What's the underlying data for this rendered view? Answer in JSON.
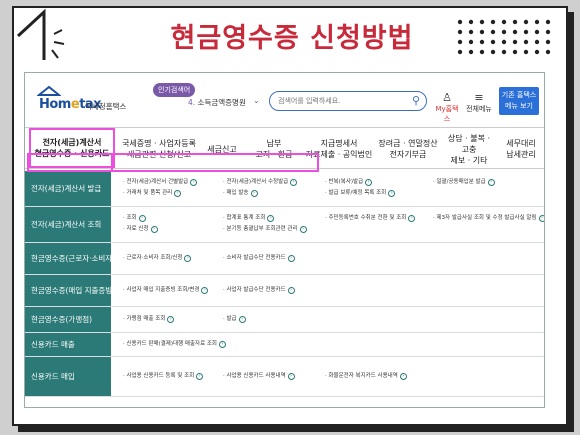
{
  "title": "현금영수증 신청방법",
  "colors": {
    "title": "#c72a3a",
    "highlight": "#ec4fe0",
    "row_head": "#2b7a78",
    "accent": "#2b6fd8"
  },
  "header": {
    "logo_name_a": "Hom",
    "logo_name_b": "e",
    "logo_name_c": "tax",
    "agency": "국세청홈택스",
    "popular_label": "인기검색어",
    "popular_num": "4.",
    "popular_item": "소득금액증명원",
    "search_placeholder": "검색어를 입력하세요.",
    "search_icon": "search-icon",
    "my_hometax": "My홈택스",
    "all_menu": "전체메뉴",
    "basic_menu_line1": "기존 홈택스",
    "basic_menu_line2": "메뉴 보기"
  },
  "tabs": [
    {
      "l1": "전자(세금)계산서",
      "l2": "현금영수증 · 신용카드"
    },
    {
      "l1": "국세증명 · 사업자등록",
      "l2": "세금관련 신청/신고"
    },
    {
      "l1": "세금신고",
      "l2": ""
    },
    {
      "l1": "납부",
      "l2": "고지 · 환급"
    },
    {
      "l1": "지급명세서",
      "l2": "자료제출 · 공익법인"
    },
    {
      "l1": "장려금 · 연말정산",
      "l2": "전자기부금"
    },
    {
      "l1": "상담 · 불복 · 고충",
      "l2": "제보 · 기타"
    },
    {
      "l1": "세무대리",
      "l2": "납세관리"
    }
  ],
  "rows": [
    {
      "head": "전자(세금)계산서 발급",
      "items": [
        "· 전자(세금)계산서 건별발급",
        "· 전자(세금)계산서 수정발급",
        "· 반복(복사)발급",
        "· 일괄/공동매입분 발급",
        "· 거래처 및 품목 관리",
        "· 매입 발송",
        "· 발급 보류/예정 목록 조회"
      ]
    },
    {
      "head": "전자(세금)계산서 조회",
      "items": [
        "· 조회",
        "· 합계표 통계 조회",
        "· 주민등록번호 수취분 전환 및 조회",
        "· 제3자 발급사실 조회 및 수정 발급사실 알림",
        "· 자료 신청",
        "· 분기등 총괄납부 조회관련 관리"
      ]
    },
    {
      "head": "현금영수증(근로자·소비자)",
      "items": [
        "· 근로자·소비자 조회/신청",
        "· 소비자 발급수단 전용카드"
      ]
    },
    {
      "head": "현금영수증(매입 지출증빙)",
      "items": [
        "· 사업자 매입 지출증빙 조회/변경",
        "· 사업자 발급수단 전용카드"
      ]
    },
    {
      "head": "현금영수증(가맹점)",
      "items": [
        "· 가맹점 매출 조회",
        "· 발급"
      ]
    },
    {
      "head": "신용카드 매출",
      "items": [
        "· 신용카드 판매(결제)대행 매출자료 조회"
      ]
    },
    {
      "head": "신용카드 매입",
      "items": [
        "· 사업용 신용카드 등록 및 조회",
        "· 사업용 신용카드 사용내역",
        "· 화물운전자 복지카드 사용내역"
      ]
    }
  ]
}
